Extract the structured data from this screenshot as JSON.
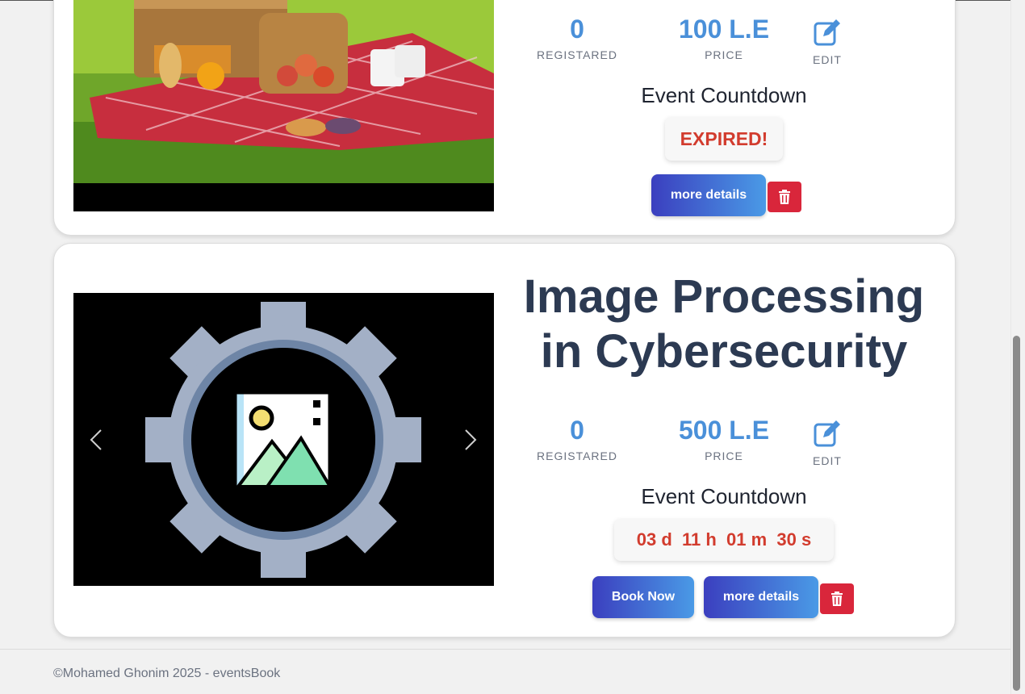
{
  "events": [
    {
      "registered": "0",
      "registered_label": "REGISTARED",
      "price": "100 L.E",
      "price_label": "PRICE",
      "edit_label": "EDIT",
      "countdown_title": "Event Countdown",
      "countdown_status": "EXPIRED!",
      "more_details_label": "more details"
    },
    {
      "title_line1": "Image Processing",
      "title_line2": "in Cybersecurity",
      "registered": "0",
      "registered_label": "REGISTARED",
      "price": "500 L.E",
      "price_label": "PRICE",
      "edit_label": "EDIT",
      "countdown_title": "Event Countdown",
      "countdown": "03 d  11 h  01 m  30 s",
      "book_now_label": "Book Now",
      "more_details_label": "more details"
    }
  ],
  "footer": {
    "text": "©Mohamed Ghonim 2025 - eventsBook"
  },
  "colors": {
    "accent": "#4a90d9",
    "danger": "#d9263b",
    "title": "#2c3a52",
    "countdown": "#d23c2e"
  }
}
